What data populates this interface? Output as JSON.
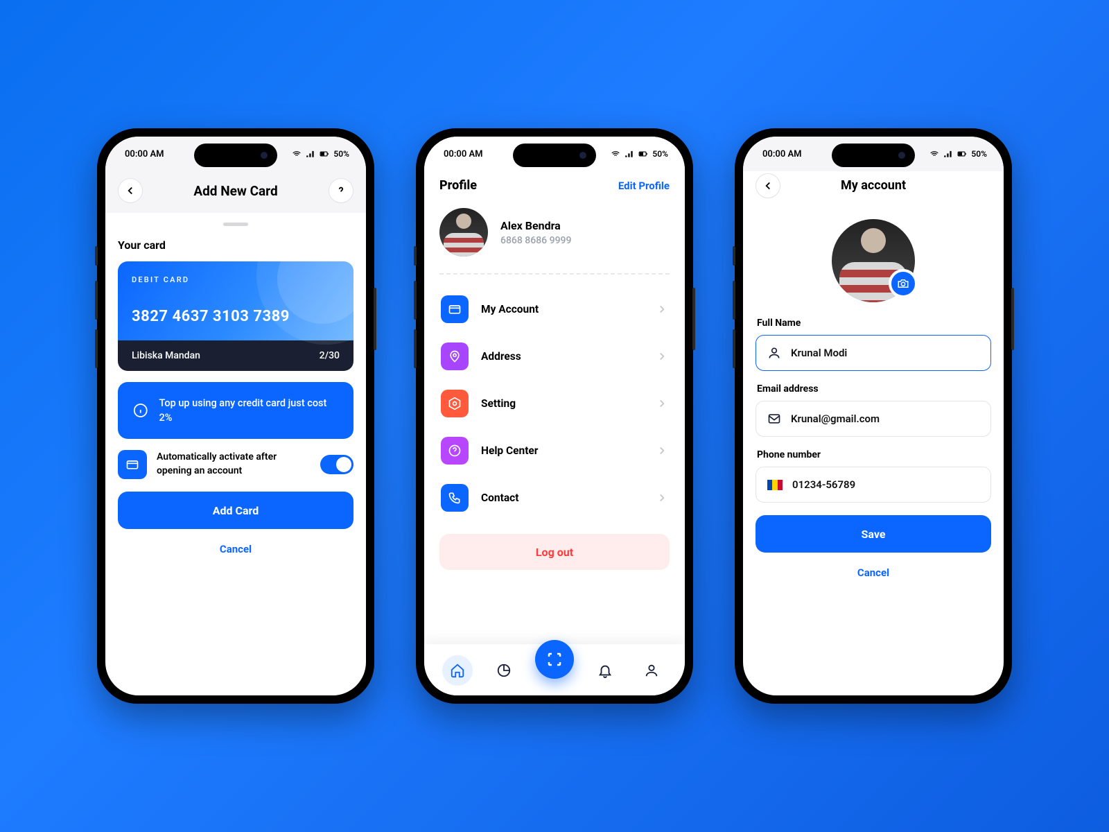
{
  "status": {
    "time": "00:00 AM",
    "battery": "50%"
  },
  "screen1": {
    "title": "Add New Card",
    "section_title": "Your card",
    "card": {
      "type": "DEBIT CARD",
      "number": "3827 4637 3103 7389",
      "holder": "Libiska Mandan",
      "expiry": "2/30"
    },
    "topup_info": "Top up using any credit card just cost 2%",
    "auto_activate": "Automatically activate after opening an account",
    "add_btn": "Add Card",
    "cancel_btn": "Cancel"
  },
  "screen2": {
    "title": "Profile",
    "edit": "Edit Profile",
    "user": {
      "name": "Alex Bendra",
      "phone": "6868 8686 9999"
    },
    "menu": {
      "account": "My Account",
      "address": "Address",
      "setting": "Setting",
      "help": "Help Center",
      "contact": "Contact"
    },
    "logout": "Log out"
  },
  "screen3": {
    "title": "My account",
    "fullname_label": "Full Name",
    "fullname": "Krunal Modi",
    "email_label": "Email address",
    "email": "Krunal@gmail.com",
    "phone_label": "Phone number",
    "phone": "01234-56789",
    "save": "Save",
    "cancel": "Cancel"
  }
}
